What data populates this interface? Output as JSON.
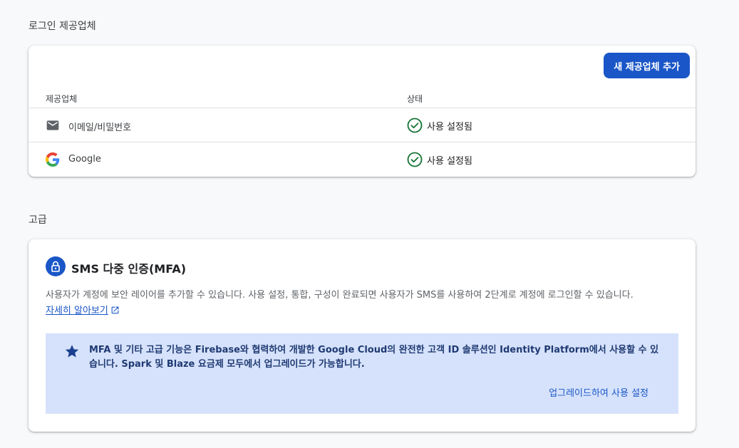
{
  "login_providers": {
    "section_title": "로그인 제공업체",
    "add_button_label": "새 제공업체 추가",
    "columns": {
      "provider": "제공업체",
      "status": "상태"
    },
    "rows": [
      {
        "provider": "이메일/비밀번호",
        "icon": "mail-icon",
        "status": "사용 설정됨",
        "status_icon": "check-circle-icon"
      },
      {
        "provider": "Google",
        "icon": "google-logo-icon",
        "status": "사용 설정됨",
        "status_icon": "check-circle-icon"
      }
    ]
  },
  "advanced": {
    "section_title": "고급",
    "mfa": {
      "icon": "lock-icon",
      "title": "SMS 다중 인증(MFA)",
      "description": "사용자가 계정에 보안 레이어를 추가할 수 있습니다. 사용 설정, 통합, 구성이 완료되면 사용자가 SMS를 사용하여 2단계로 계정에 로그인할 수 있습니다.",
      "learn_more_label": "자세히 알아보기",
      "notice": {
        "icon": "star-icon",
        "text": "MFA 및 기타 고급 기능은 Firebase와 협력하여 개발한 Google Cloud의 완전한 고객 ID 솔루션인 Identity Platform에서 사용할 수 있습니다. Spark 및 Blaze 요금제 모두에서 업그레이드가 가능합니다.",
        "action_label": "업그레이드하여 사용 설정"
      }
    }
  },
  "colors": {
    "primary": "#1a56c7",
    "success": "#137333",
    "notice_bg": "#d6e2fb"
  }
}
